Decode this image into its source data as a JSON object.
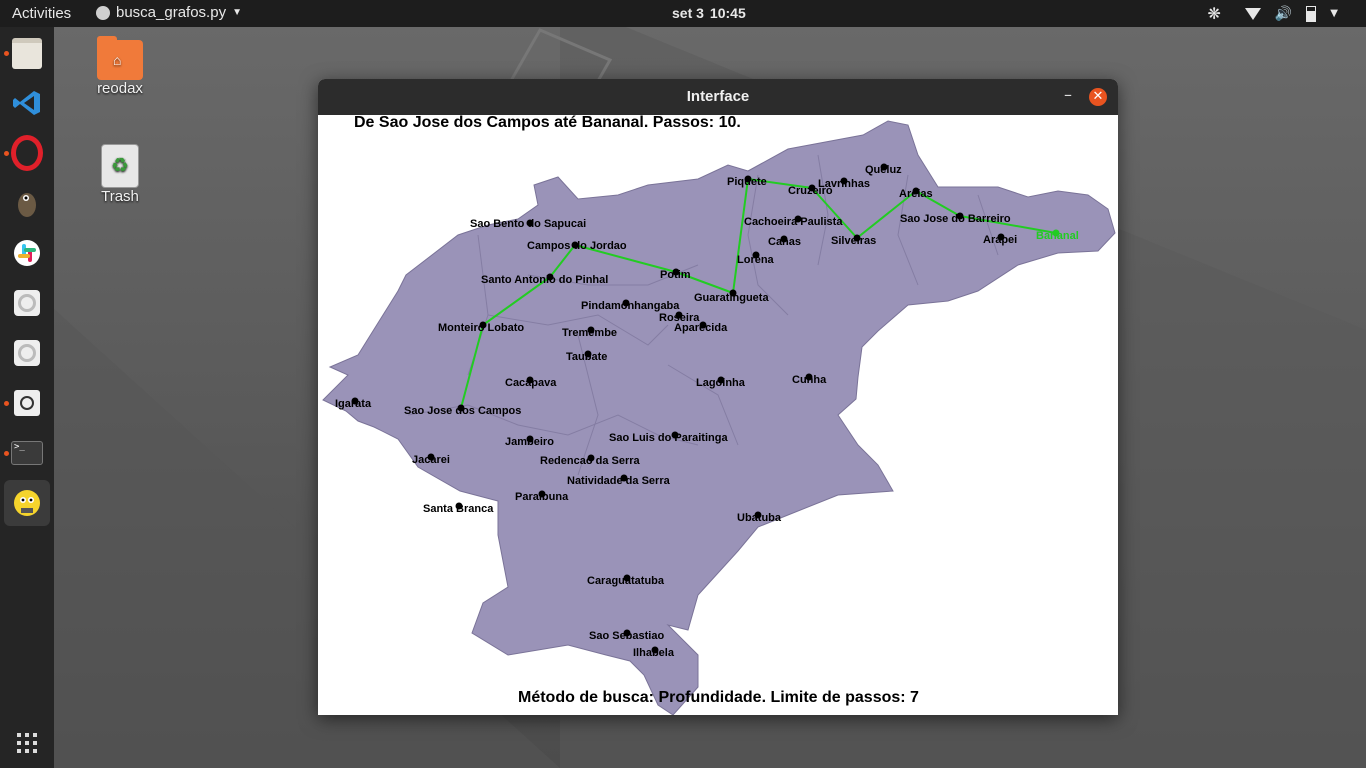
{
  "topbar": {
    "activities": "Activities",
    "app_name": "busca_grafos.py",
    "date": "set 3",
    "time": "10:45"
  },
  "dock": {
    "items": [
      {
        "name": "files-icon"
      },
      {
        "name": "vscode-icon"
      },
      {
        "name": "opera-icon"
      },
      {
        "name": "gimp-icon"
      },
      {
        "name": "slack-icon"
      },
      {
        "name": "settings-icon-1"
      },
      {
        "name": "settings-icon-2"
      },
      {
        "name": "image-viewer-icon"
      },
      {
        "name": "terminal-icon"
      },
      {
        "name": "python-icon"
      }
    ],
    "show_apps": "show-apps-icon"
  },
  "desktop": {
    "home_label": "reodax",
    "trash_label": "Trash"
  },
  "window": {
    "title": "Interface",
    "header_text": "De Sao Jose dos Campos até Bananal. Passos: 10.",
    "footer_text": "Método de busca: Profundidade. Limite de passos: 7"
  },
  "map": {
    "fill_color": "#9a93b8",
    "path_color": "#22cc22",
    "cities": [
      {
        "name": "Sao Bento do Sapucai"
      },
      {
        "name": "Campos do Jordao"
      },
      {
        "name": "Santo Antonio do Pinhal"
      },
      {
        "name": "Monteiro Lobato"
      },
      {
        "name": "Sao Jose dos Campos"
      },
      {
        "name": "Igarata"
      },
      {
        "name": "Jacarei"
      },
      {
        "name": "Santa Branca"
      },
      {
        "name": "Jambeiro"
      },
      {
        "name": "Cacapava"
      },
      {
        "name": "Taubate"
      },
      {
        "name": "Tremembe"
      },
      {
        "name": "Pindamonhangaba"
      },
      {
        "name": "Roseira"
      },
      {
        "name": "Aparecida"
      },
      {
        "name": "Potim"
      },
      {
        "name": "Guaratingueta"
      },
      {
        "name": "Lorena"
      },
      {
        "name": "Canas"
      },
      {
        "name": "Cachoeira Paulista"
      },
      {
        "name": "Piquete"
      },
      {
        "name": "Cruzeiro"
      },
      {
        "name": "Lavrinhas"
      },
      {
        "name": "Queluz"
      },
      {
        "name": "Silveiras"
      },
      {
        "name": "Areias"
      },
      {
        "name": "Sao Jose do Barreiro"
      },
      {
        "name": "Arapei"
      },
      {
        "name": "Bananal"
      },
      {
        "name": "Lagoinha"
      },
      {
        "name": "Cunha"
      },
      {
        "name": "Sao Luis do Paraitinga"
      },
      {
        "name": "Redencao da Serra"
      },
      {
        "name": "Natividade da Serra"
      },
      {
        "name": "Paraibuna"
      },
      {
        "name": "Ubatuba"
      },
      {
        "name": "Caraguatatuba"
      },
      {
        "name": "Sao Sebastiao"
      },
      {
        "name": "Ilhabela"
      }
    ],
    "route": [
      "Sao Jose dos Campos",
      "Monteiro Lobato",
      "Santo Antonio do Pinhal",
      "Campos do Jordao",
      "Potim",
      "Guaratingueta",
      "Piquete",
      "Cruzeiro",
      "Silveiras",
      "Areias",
      "Sao Jose do Barreiro",
      "Bananal"
    ]
  }
}
